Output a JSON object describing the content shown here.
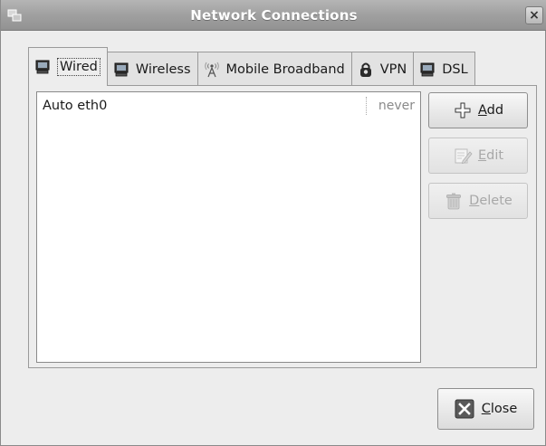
{
  "window": {
    "title": "Network Connections"
  },
  "titlebar": {
    "menu_icon": "window-menu-icon",
    "close_glyph": "×"
  },
  "tabs": [
    {
      "label": "Wired",
      "icon": "wired-network-icon",
      "active": true
    },
    {
      "label": "Wireless",
      "icon": "wireless-network-icon",
      "active": false
    },
    {
      "label": "Mobile Broadband",
      "icon": "mobile-broadband-icon",
      "active": false
    },
    {
      "label": "VPN",
      "icon": "vpn-lock-icon",
      "active": false
    },
    {
      "label": "DSL",
      "icon": "dsl-network-icon",
      "active": false
    }
  ],
  "connections": [
    {
      "name": "Auto eth0",
      "last_used": "never"
    }
  ],
  "buttons": {
    "add": {
      "mnemonic": "A",
      "rest": "dd",
      "enabled": true
    },
    "edit": {
      "mnemonic": "E",
      "rest": "dit",
      "enabled": false
    },
    "delete": {
      "mnemonic": "D",
      "rest": "elete",
      "enabled": false
    },
    "close": {
      "mnemonic": "C",
      "rest": "lose",
      "enabled": true
    }
  }
}
